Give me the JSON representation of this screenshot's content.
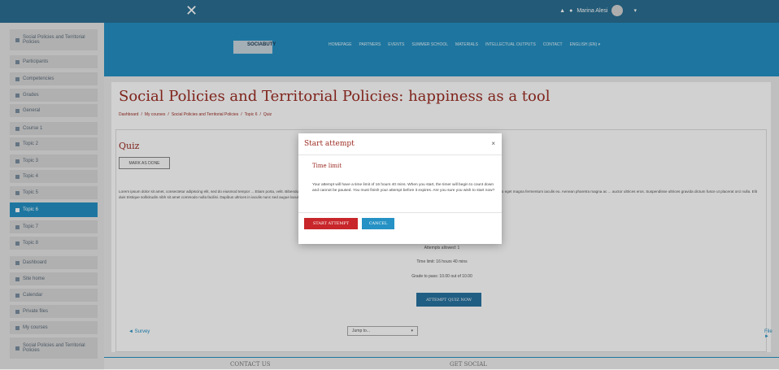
{
  "topbar": {
    "close_glyph": "✕",
    "user_name": "Marina Alesi",
    "bell_icon": "bell-icon",
    "chat_icon": "chat-icon",
    "caret": "▾"
  },
  "sidebar": {
    "items": [
      {
        "label": "Social Policies and Territorial Policies",
        "icon": "graduation-cap-icon"
      },
      {
        "label": "Participants",
        "icon": "users-icon"
      },
      {
        "label": "Competencies",
        "icon": "check-square-icon"
      },
      {
        "label": "Grades",
        "icon": "table-icon"
      },
      {
        "label": "General",
        "icon": "folder-icon"
      },
      {
        "label": "Course 1",
        "icon": "folder-icon"
      },
      {
        "label": "Topic 2",
        "icon": "folder-icon"
      },
      {
        "label": "Topic 3",
        "icon": "folder-icon"
      },
      {
        "label": "Topic 4",
        "icon": "folder-icon"
      },
      {
        "label": "Topic 5",
        "icon": "folder-icon"
      },
      {
        "label": "Topic 6",
        "icon": "folder-icon",
        "active": true
      },
      {
        "label": "Topic 7",
        "icon": "folder-icon"
      },
      {
        "label": "Topic 8",
        "icon": "folder-icon"
      },
      {
        "label": "Dashboard",
        "icon": "dashboard-icon"
      },
      {
        "label": "Site home",
        "icon": "home-icon"
      },
      {
        "label": "Calendar",
        "icon": "calendar-icon"
      },
      {
        "label": "Private files",
        "icon": "file-icon"
      },
      {
        "label": "My courses",
        "icon": "graduation-cap-icon"
      },
      {
        "label": "Social Policies and Territorial Policies",
        "icon": "graduation-cap-icon"
      }
    ]
  },
  "brand": {
    "logo_text": "SOCIABUTY",
    "nav": [
      "HOMEPAGE",
      "PARTNERS",
      "EVENTS",
      "SUMMER SCHOOL",
      "MATERIALS",
      "INTELLECTUAL OUTPUTS",
      "CONTACT",
      "ENGLISH (EN) ▾"
    ]
  },
  "page": {
    "title": "Social Policies and Territorial Policies: happiness as a tool",
    "breadcrumbs": [
      "Dashboard",
      "/",
      "My courses",
      "/",
      "Social Policies and Territorial Policies",
      "/",
      "Topic 6",
      "/",
      "Quiz"
    ]
  },
  "quiz": {
    "title": "Quiz",
    "mark_done": "MARK AS DONE",
    "description": "Lorem ipsum dolor sit amet, consectetur adipiscing elit, sed do eiusmod tempor ... Etiam porta, velit. Bibendum arcu vitae elementum curabitur vitae nunc sed velit dignissim. Enim tortor at auctor urna nunc id cursus metus. Vitae justo eget magna fermentum iaculis eu. Aenean pharetra magna ac ... auctor ultrices eros. Suspendisse ultrices gravida dictum fusce ut placerat orci nulla. Elit duis tristique sollicitudin nibh sit amet commodo nulla facilisi. Dapibus ultrices in iaculis nunc sed augue lacus viverra.",
    "attempts_allowed": "Attempts allowed: 1",
    "time_limit": "Time limit: 16 hours 40 mins",
    "grade_to_pass": "Grade to pass: 10.00 out of 10.00",
    "attempt_button": "ATTEMPT QUIZ NOW",
    "prev_link": "◄ Survey",
    "jump_placeholder": "Jump to...",
    "jump_caret": "▾",
    "next_link": "File ►"
  },
  "footer": {
    "contact": "CONTACT US",
    "social": "GET SOCIAL"
  },
  "modal": {
    "title": "Start attempt",
    "close": "×",
    "subtitle": "Time limit",
    "body": "Your attempt will have a time limit of 16 hours 40 mins. When you start, the timer will begin to count down and cannot be paused. You must finish your attempt before it expires. Are you sure you wish to start now?",
    "start": "START ATTEMPT",
    "cancel": "CANCEL"
  }
}
